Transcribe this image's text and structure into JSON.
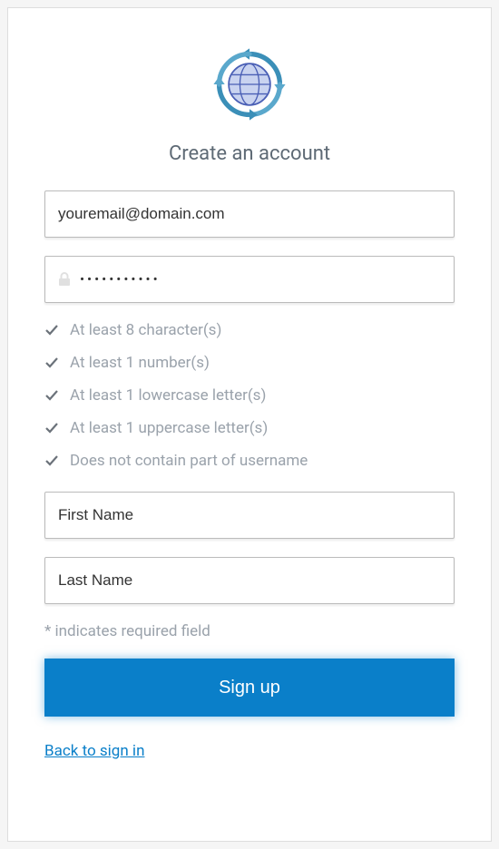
{
  "title": "Create an account",
  "form": {
    "email_value": "youremail@domain.com",
    "password_masked": "•••••••••••",
    "firstname_placeholder": "First Name",
    "lastname_placeholder": "Last Name"
  },
  "rules": [
    "At least 8 character(s)",
    "At least 1 number(s)",
    "At least 1 lowercase letter(s)",
    "At least 1 uppercase letter(s)",
    "Does not contain part of username"
  ],
  "hint": "* indicates required field",
  "signup_label": "Sign up",
  "back_link": "Back to sign in"
}
